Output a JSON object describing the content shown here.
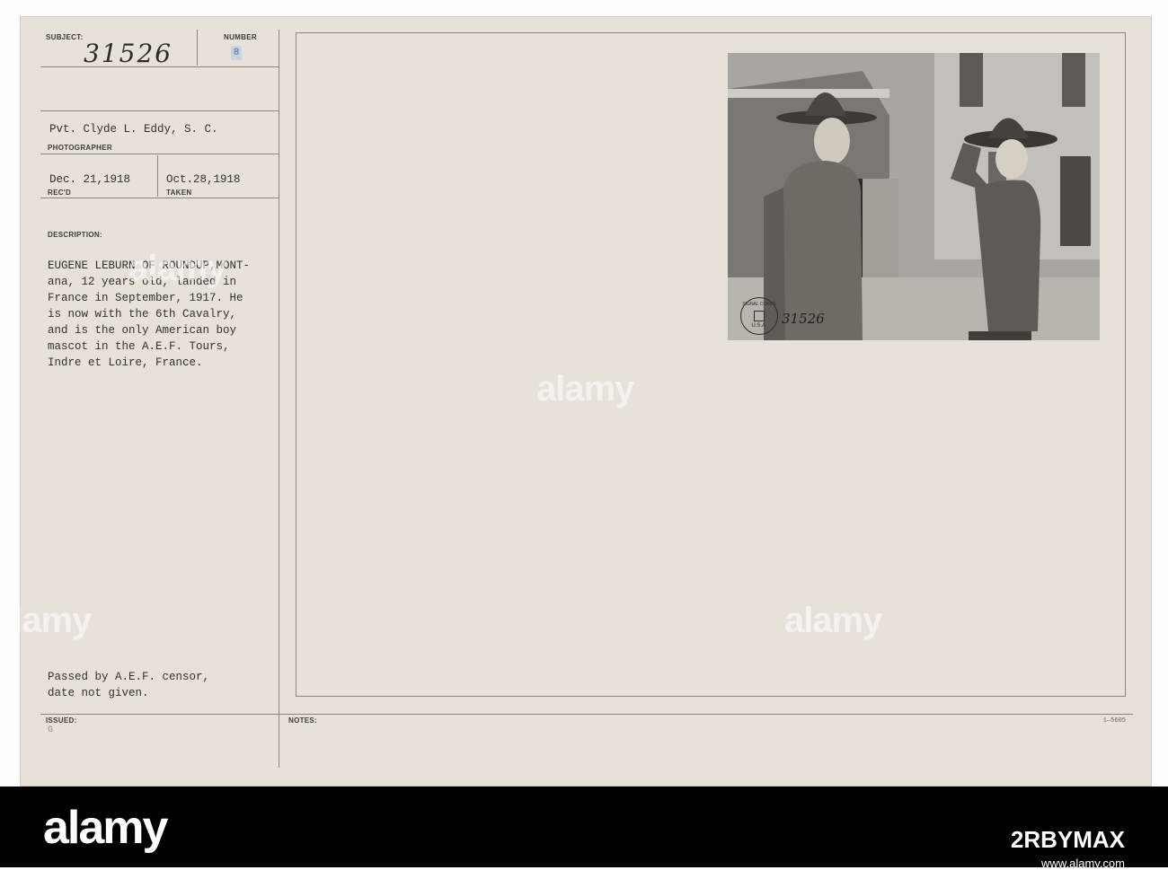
{
  "card": {
    "subject_label": "SUBJECT:",
    "subject_number": "31526",
    "number_label": "NUMBER",
    "number_value": "8",
    "photographer_name": "Pvt. Clyde L. Eddy, S. C.",
    "photographer_label": "PHOTOGRAPHER",
    "received_date": "Dec. 21,1918",
    "received_label": "REC'D",
    "taken_date": "Oct.28,1918",
    "taken_label": "TAKEN",
    "description_label": "DESCRIPTION:",
    "description_lines": [
      "EUGENE LEBURN OF ROUNDUP,MONT-",
      "ana, 12 years old, landed in",
      "France in September, 1917. He",
      "is now with the 6th Cavalry,",
      "and is the only American boy",
      "mascot in the A.E.F. Tours,",
      "Indre et Loire, France."
    ],
    "censor_lines": [
      "Passed by A.E.F. censor,",
      "date not given."
    ],
    "issued_label": "ISSUED:",
    "issued_value": "G",
    "notes_label": "NOTES:",
    "form_code": "1—5605"
  },
  "photo": {
    "stamp_text": "SIGNAL CORPS",
    "stamp_usa": "U.S.A.",
    "photo_number": "31526"
  },
  "watermark": {
    "text": "alamy"
  },
  "footer": {
    "logo": "alamy",
    "image_id": "2RBYMAX",
    "site": "www.alamy.com"
  },
  "colors": {
    "card_background": "#e7e1d9",
    "footer_background": "#000000"
  }
}
